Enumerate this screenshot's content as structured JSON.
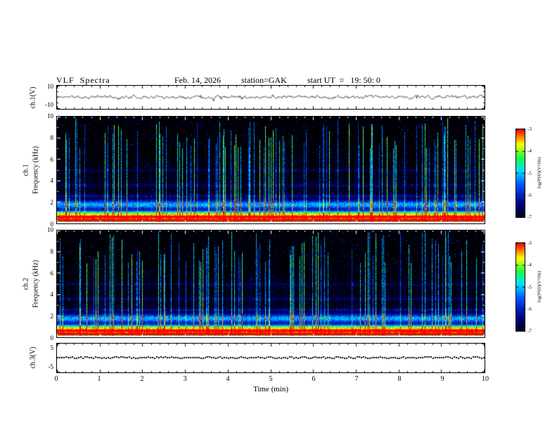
{
  "header": {
    "title": "VLF  Spectra",
    "date": "Feb. 14, 2026",
    "station": "station=GAK",
    "start_ut": "start UT  =   19: 50: 0"
  },
  "axes": {
    "time_label": "Time (min)",
    "x_ticks": [
      "0",
      "1",
      "2",
      "3",
      "4",
      "5",
      "6",
      "7",
      "8",
      "9",
      "10"
    ]
  },
  "panels": {
    "ch1_wave": {
      "ylabel": "ch.1(V)",
      "ymax_label": "10",
      "ymin_label": "-10"
    },
    "ch1_spec": {
      "channel_label": "ch.1",
      "ylabel": "Frequency (kHz)",
      "yticks": [
        "10",
        "8",
        "6",
        "4",
        "2",
        "0"
      ]
    },
    "ch2_spec": {
      "channel_label": "ch.2",
      "ylabel": "Frequency (kHz)",
      "yticks": [
        "10",
        "8",
        "6",
        "4",
        "2",
        "0"
      ]
    },
    "ch3_wave": {
      "ylabel": "ch.3(V)",
      "ymax_label": "5",
      "ymin_label": "-5"
    }
  },
  "colorbar": {
    "label": "log(PSD)(V²/Hz)",
    "ticks": [
      "-3",
      "-4",
      "-5",
      "-6",
      "-7"
    ],
    "zlim": [
      -7,
      -3
    ],
    "colors": {
      "max": "#ff0000",
      "high": "#ffff00",
      "mid": "#00ff50",
      "low": "#0050ff",
      "min": "#000000"
    }
  },
  "chart_data": [
    {
      "type": "line",
      "name": "ch1_waveform",
      "ylabel": "ch.1(V)",
      "xlim": [
        0,
        10
      ],
      "ylim": [
        -10,
        10
      ],
      "yticks": [
        -10,
        10
      ],
      "seed": 11,
      "description": "Band-limited noise waveform fluctuating around 0 V, typical amplitude ±3 V with occasional spikes to ±5 V across the full 10-minute record"
    },
    {
      "type": "heatmap",
      "name": "ch1_spectrogram",
      "title": "ch.1 VLF spectrogram",
      "xlabel": "Time (min)",
      "ylabel": "Frequency (kHz)",
      "xlim": [
        0,
        10
      ],
      "ylim": [
        0,
        10
      ],
      "yticks": [
        0,
        2,
        4,
        6,
        8,
        10
      ],
      "zlabel": "log(PSD)(V²/Hz)",
      "zlim": [
        -7,
        -3
      ],
      "seed": 12,
      "features": [
        "intense narrow emission band near 0.3 kHz reaching -3 (red), flanked by yellow ~0.6 kHz and green ~1 kHz",
        "diffuse blue noise below 3 kHz with a speckled band near 1.8 kHz",
        "weak horizontal lines near 2.6, 3.6 and 5 kHz",
        "many vertical broadband impulsive streaks (sferics) in blue/cyan/green extending to 10 kHz",
        "background between streaks above 3 kHz mostly at or below -7 (black)"
      ]
    },
    {
      "type": "heatmap",
      "name": "ch2_spectrogram",
      "title": "ch.2 VLF spectrogram",
      "xlabel": "Time (min)",
      "ylabel": "Frequency (kHz)",
      "xlim": [
        0,
        10
      ],
      "ylim": [
        0,
        10
      ],
      "yticks": [
        0,
        2,
        4,
        6,
        8,
        10
      ],
      "zlabel": "log(PSD)(V²/Hz)",
      "zlim": [
        -7,
        -3
      ],
      "seed": 13,
      "features": [
        "same structure as ch.1: red/yellow band below 1 kHz, blue diffuse activity below 3 kHz, dense vertical sferic streaks up to 10 kHz"
      ]
    },
    {
      "type": "line",
      "name": "ch3_waveform",
      "ylabel": "ch.3(V)",
      "xlim": [
        0,
        10
      ],
      "ylim": [
        -5,
        5
      ],
      "yticks": [
        -5,
        5
      ],
      "seed": 14,
      "description": "Nearly constant signal at ~0 V rendered as a dense dark dotted trace"
    }
  ]
}
